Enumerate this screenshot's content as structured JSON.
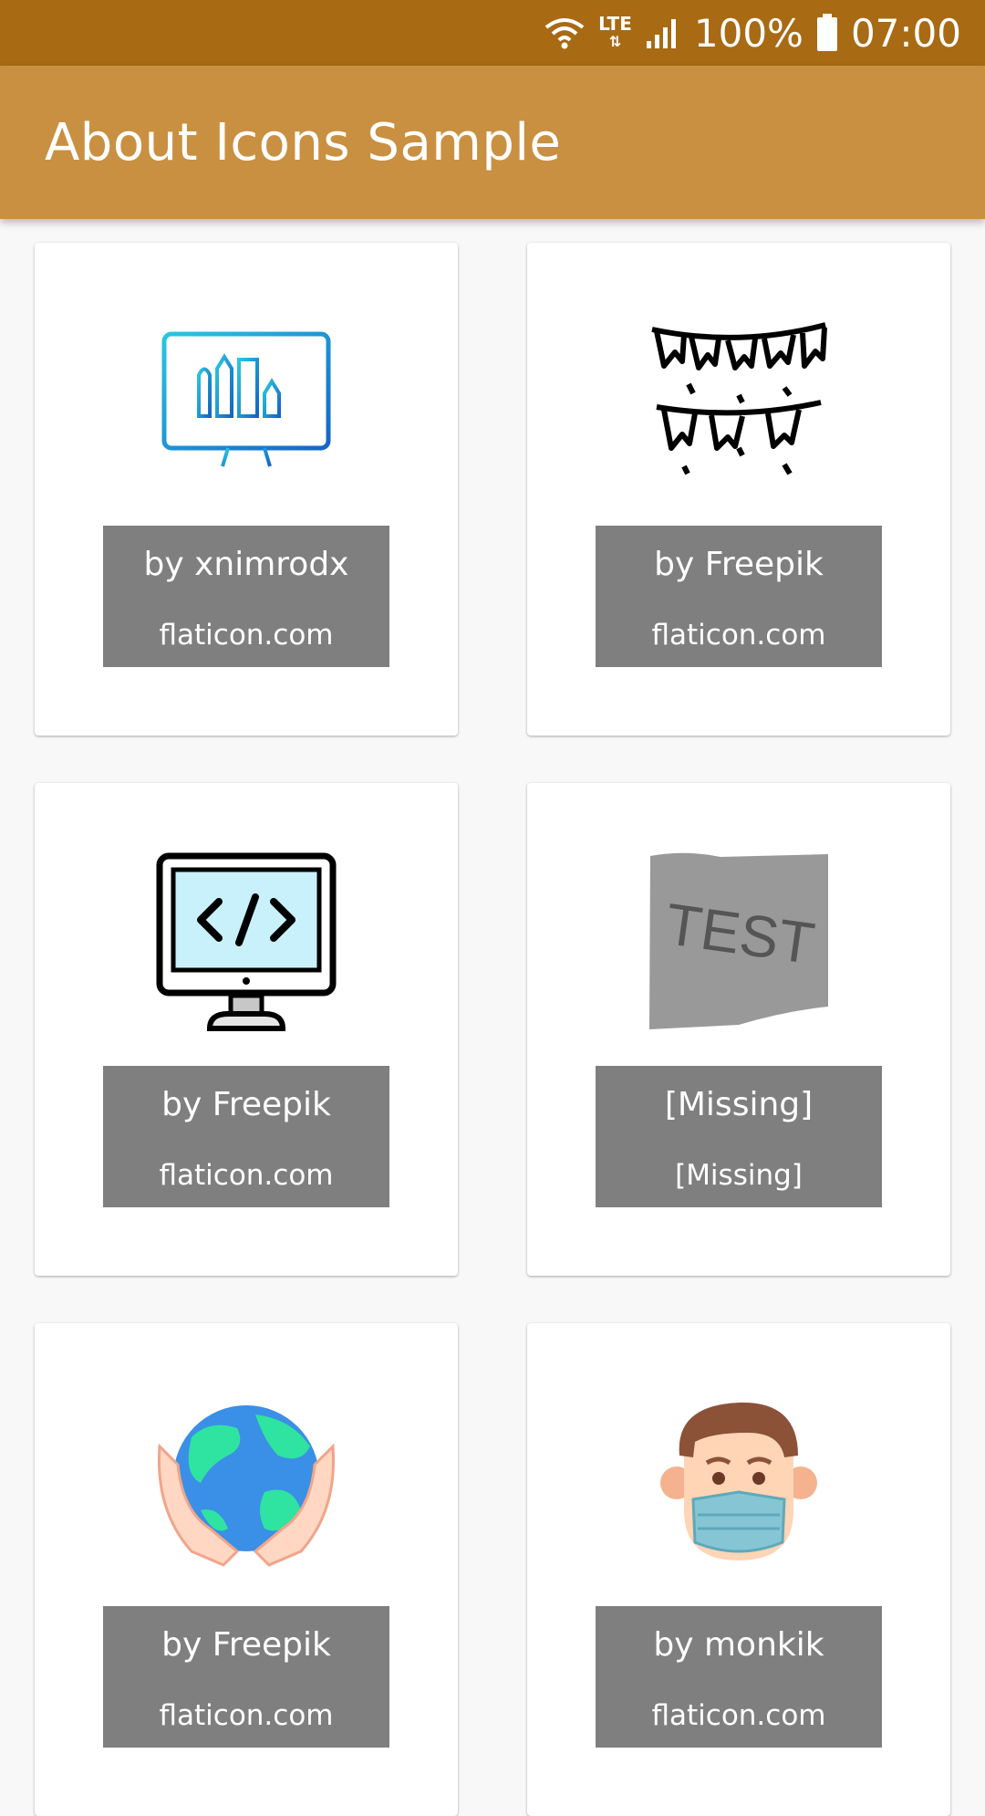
{
  "status_bar": {
    "network": "LTE",
    "battery": "100%",
    "time": "07:00"
  },
  "app_bar": {
    "title": "About Icons Sample"
  },
  "cards": [
    {
      "icon": "monitor-design-tools-icon",
      "author": "by xnimrodx",
      "source": "flaticon.com"
    },
    {
      "icon": "bunting-flags-icon",
      "author": "by Freepik",
      "source": "flaticon.com"
    },
    {
      "icon": "code-monitor-icon",
      "author": "by Freepik",
      "source": "flaticon.com"
    },
    {
      "icon": "test-placeholder-icon",
      "icon_text": "TEST",
      "author": "[Missing]",
      "source": "[Missing]"
    },
    {
      "icon": "earth-in-hands-icon",
      "author": "by Freepik",
      "source": "flaticon.com"
    },
    {
      "icon": "man-with-mask-icon",
      "author": "by monkik",
      "source": "flaticon.com"
    }
  ],
  "colors": {
    "status_bar": "#a86a13",
    "app_bar": "#c99041",
    "credit_bg": "#7f7f7f",
    "page_bg": "#f8f8f8"
  }
}
